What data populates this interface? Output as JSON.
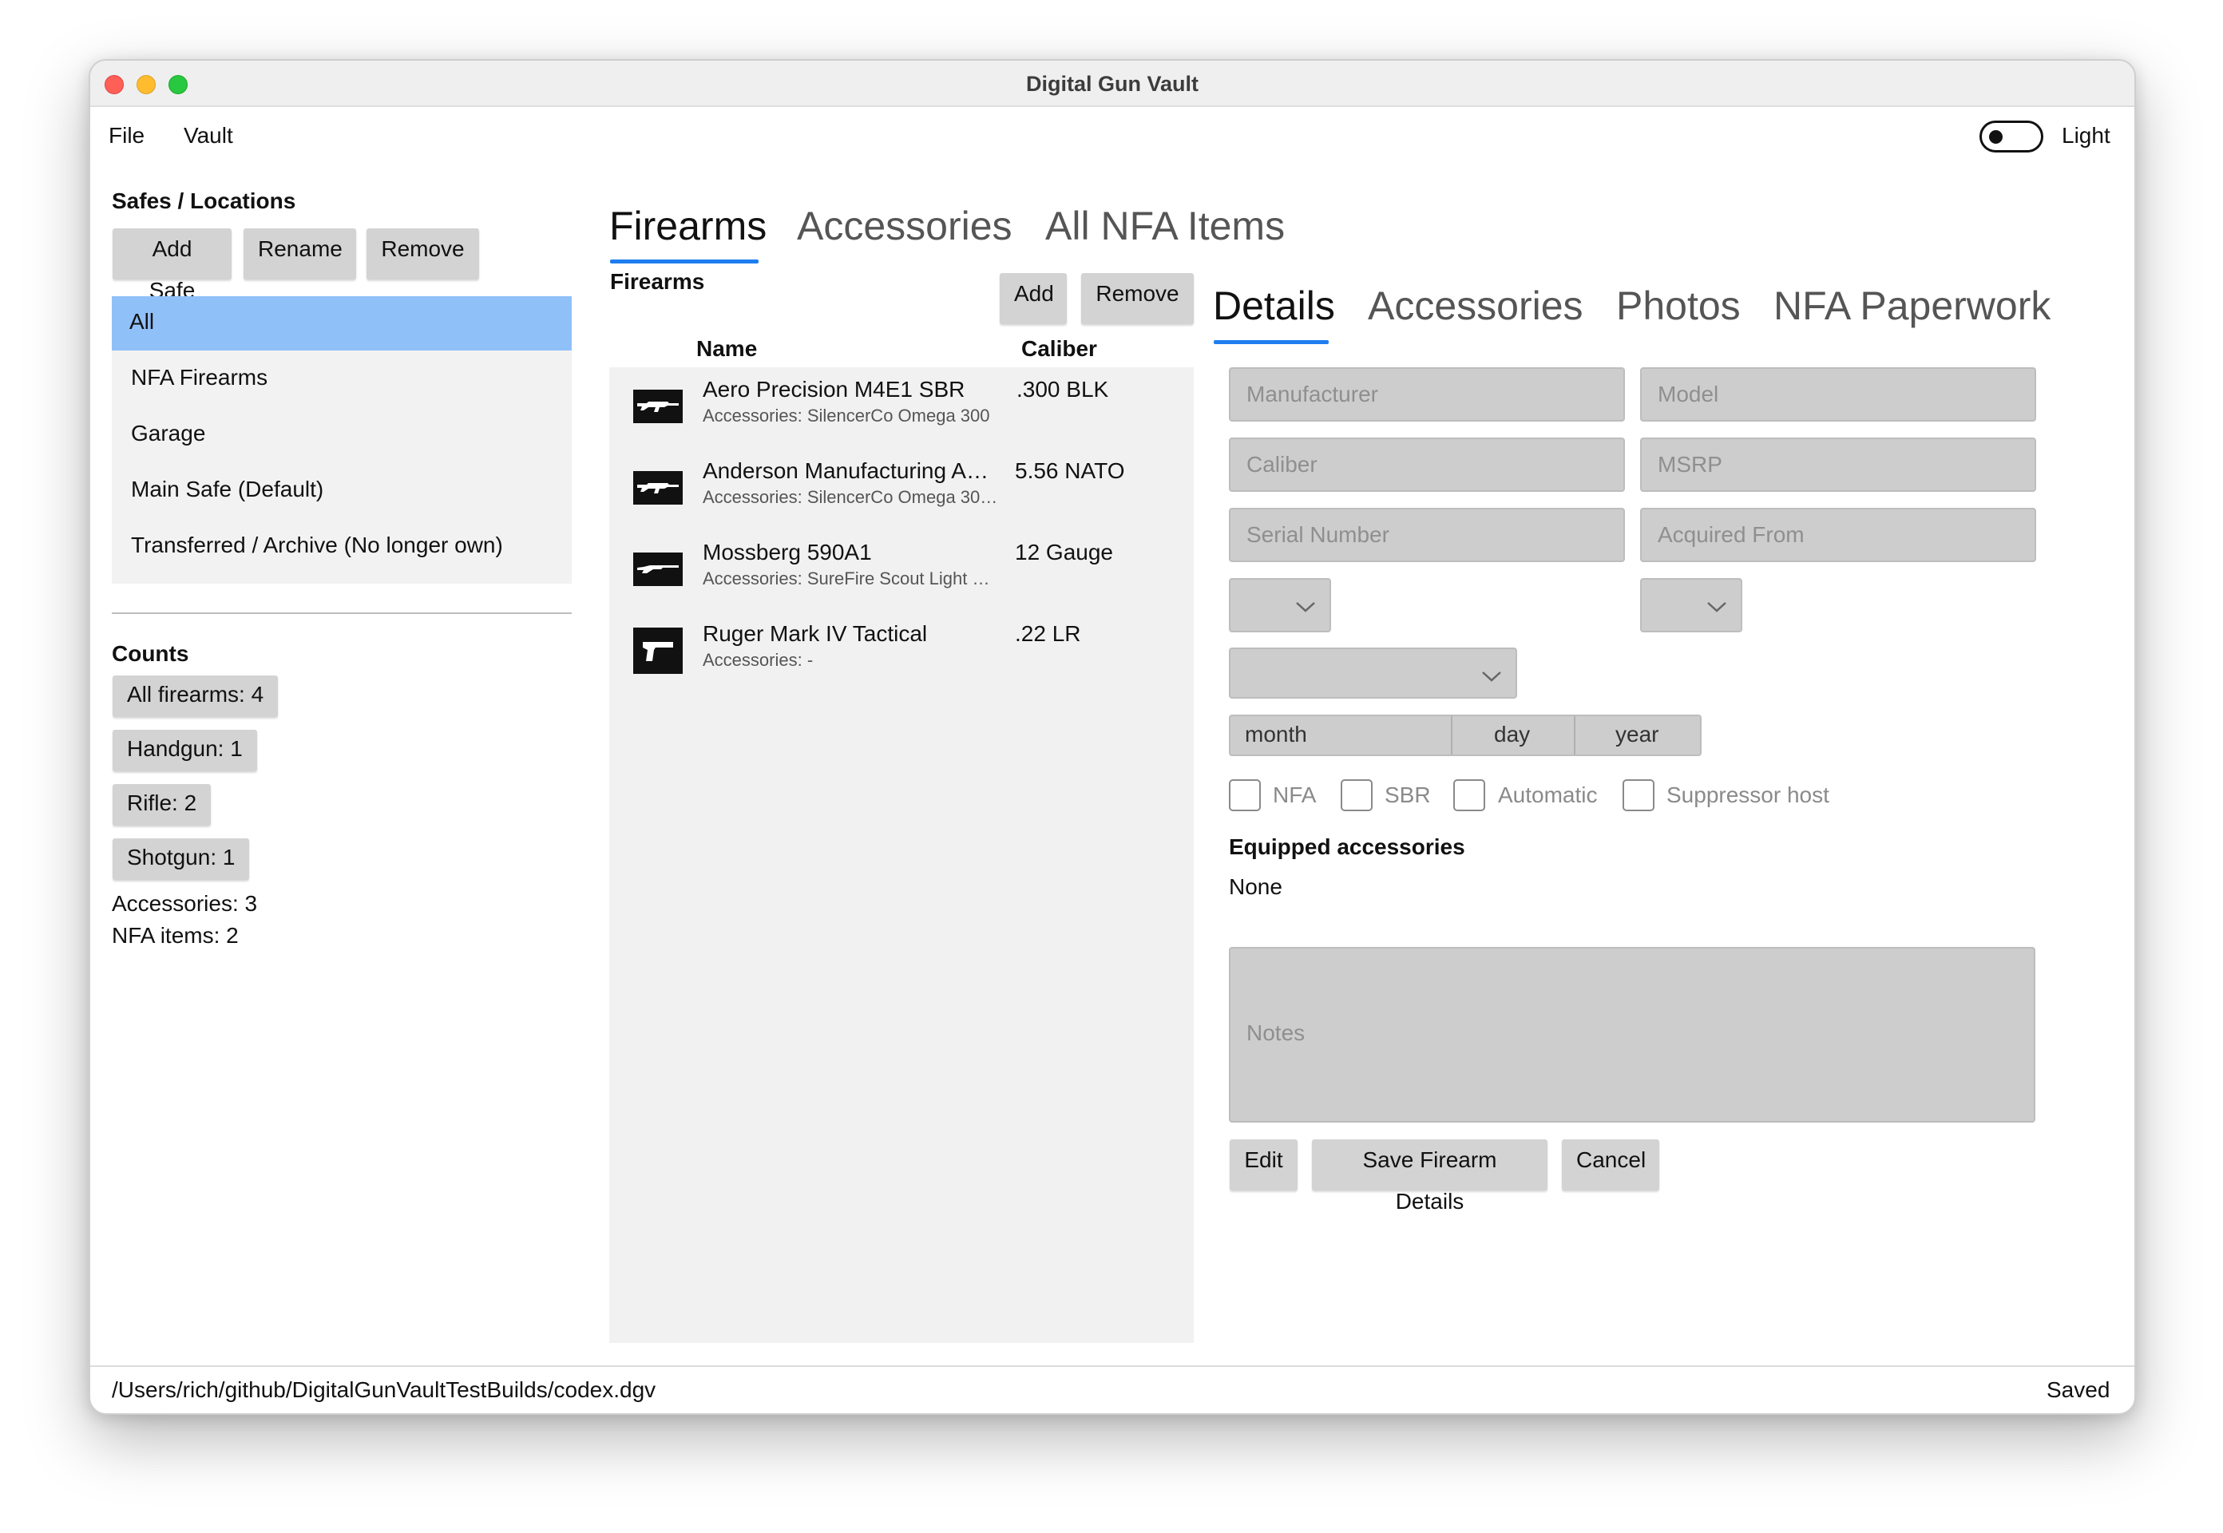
{
  "window": {
    "title": "Digital Gun Vault"
  },
  "menu": {
    "file": "File",
    "vault": "Vault"
  },
  "theme": {
    "label": "Light",
    "on": false
  },
  "safes": {
    "title": "Safes / Locations",
    "buttons": {
      "add": "Add Safe",
      "rename": "Rename",
      "remove": "Remove"
    },
    "items": [
      {
        "label": "All",
        "selected": true
      },
      {
        "label": "NFA Firearms"
      },
      {
        "label": "Garage"
      },
      {
        "label": "Main Safe (Default)"
      },
      {
        "label": "Transferred / Archive (No longer own)"
      }
    ]
  },
  "counts": {
    "title": "Counts",
    "chips": [
      "All firearms: 4",
      "Handgun: 1",
      "Rifle: 2",
      "Shotgun: 1"
    ],
    "accessories": "Accessories: 3",
    "nfa_items": "NFA items: 2"
  },
  "main_tabs": [
    "Firearms",
    "Accessories",
    "All NFA Items"
  ],
  "firearms": {
    "title": "Firearms",
    "add": "Add",
    "remove": "Remove",
    "col_name": "Name",
    "col_caliber": "Caliber",
    "rows": [
      {
        "name": "Aero Precision M4E1 SBR",
        "accessories": "Accessories: SilencerCo Omega 300",
        "caliber": ".300 BLK",
        "icon": "rifle-icon"
      },
      {
        "name": "Anderson Manufacturing A…",
        "accessories": "Accessories: SilencerCo Omega 30…",
        "caliber": "5.56 NATO",
        "icon": "rifle-icon"
      },
      {
        "name": "Mossberg 590A1",
        "accessories": "Accessories: SureFire Scout Light …",
        "caliber": "12 Gauge",
        "icon": "shotgun-icon"
      },
      {
        "name": "Ruger Mark IV Tactical",
        "accessories": "Accessories: -",
        "caliber": ".22 LR",
        "icon": "pistol-icon"
      }
    ]
  },
  "detail_tabs": [
    "Details",
    "Accessories",
    "Photos",
    "NFA Paperwork"
  ],
  "details": {
    "manufacturer_ph": "Manufacturer",
    "model_ph": "Model",
    "caliber_ph": "Caliber",
    "msrp_ph": "MSRP",
    "serial_ph": "Serial Number",
    "acquired_ph": "Acquired From",
    "date": {
      "month": "month",
      "day": "day",
      "year": "year"
    },
    "checks": [
      "NFA",
      "SBR",
      "Automatic",
      "Suppressor host"
    ],
    "equipped_title": "Equipped accessories",
    "equipped_value": "None",
    "notes_ph": "Notes",
    "buttons": {
      "edit": "Edit",
      "save": "Save Firearm Details",
      "cancel": "Cancel"
    }
  },
  "status": {
    "path": "/Users/rich/github/DigitalGunVaultTestBuilds/codex.dgv",
    "state": "Saved"
  },
  "colors": {
    "accent": "#1e7ef0",
    "selection": "#90c0f8",
    "field_bg": "#cdcdcd"
  }
}
